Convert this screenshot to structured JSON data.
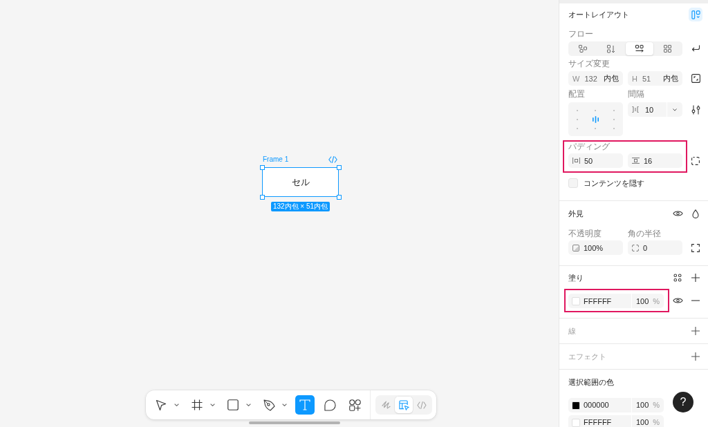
{
  "canvas": {
    "frame": {
      "title": "Frame 1",
      "text": "セル",
      "size_badge": "132内包 × 51内包",
      "selected": true
    }
  },
  "toolbar": {
    "tools": [
      {
        "kind": "move",
        "menu": true,
        "selected": false
      },
      {
        "kind": "frame",
        "menu": true,
        "selected": false
      },
      {
        "kind": "shape",
        "menu": true,
        "selected": false
      },
      {
        "kind": "pen",
        "menu": true,
        "selected": false
      },
      {
        "kind": "text",
        "menu": false,
        "selected": true
      },
      {
        "kind": "comment",
        "menu": false,
        "selected": false
      },
      {
        "kind": "assets",
        "menu": false,
        "selected": false
      }
    ],
    "modes": [
      {
        "kind": "draw",
        "selected": false
      },
      {
        "kind": "design",
        "selected": true
      },
      {
        "kind": "dev",
        "selected": false
      }
    ]
  },
  "panel": {
    "auto_layout": {
      "title": "オートレイアウト",
      "on": true,
      "flow": {
        "label": "フロー",
        "options": [
          {
            "kind": "free",
            "selected": false
          },
          {
            "kind": "vertical",
            "selected": false
          },
          {
            "kind": "horizontal",
            "selected": true
          },
          {
            "kind": "grid",
            "selected": false
          }
        ]
      },
      "resize": {
        "label": "サイズ変更",
        "fields": [
          {
            "axis": "W",
            "value": "132",
            "mode": "内包"
          },
          {
            "axis": "H",
            "value": "51",
            "mode": "内包"
          }
        ]
      },
      "alignment": {
        "label": "配置",
        "cells": [
          {
            "selected": false
          },
          {
            "selected": false
          },
          {
            "selected": false
          },
          {
            "selected": false
          },
          {
            "selected": true
          },
          {
            "selected": false
          },
          {
            "selected": false
          },
          {
            "selected": false
          },
          {
            "selected": false
          }
        ]
      },
      "gap": {
        "label": "間隔",
        "value": "10"
      },
      "padding": {
        "label": "パディング",
        "horizontal": "50",
        "vertical": "16",
        "highlighted": true
      },
      "clip_content": {
        "label": "コンテンツを隠す",
        "checked": false
      }
    },
    "appearance": {
      "title": "外見",
      "opacity": {
        "label": "不透明度",
        "value": "100%"
      },
      "radius": {
        "label": "角の半径",
        "value": "0"
      }
    },
    "fill": {
      "title": "塗り",
      "items": [
        {
          "color": "#ffffff",
          "hex": "FFFFFF",
          "opacity": "100",
          "unit": "%",
          "highlighted": true
        }
      ]
    },
    "stroke": {
      "title": "線",
      "empty": true
    },
    "effects": {
      "title": "エフェクト",
      "empty": true
    },
    "selection_colors": {
      "title": "選択範囲の色",
      "items": [
        {
          "color": "#000000",
          "hex": "000000",
          "opacity": "100",
          "unit": "%"
        },
        {
          "color": "#ffffff",
          "hex": "FFFFFF",
          "opacity": "100",
          "unit": "%"
        }
      ]
    }
  },
  "help_button": {
    "label": "?"
  }
}
